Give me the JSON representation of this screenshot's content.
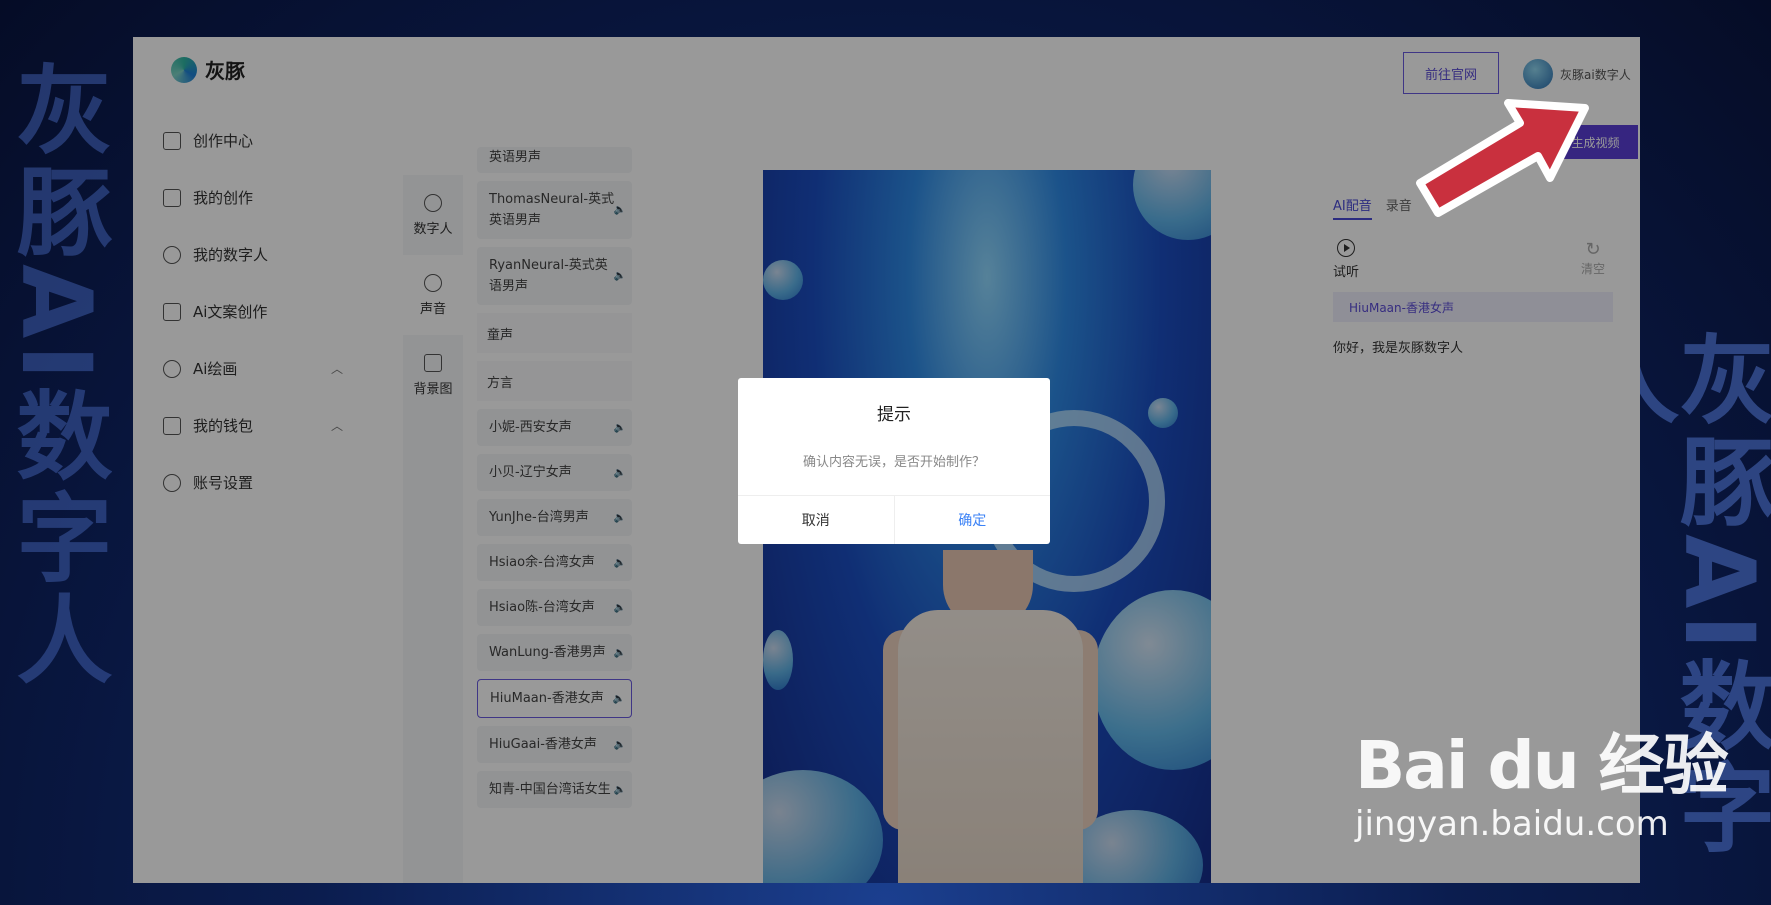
{
  "side_text_left": "灰豚AI数字人",
  "side_text_right": "灰豚AI数字人",
  "app": {
    "logo_text": "灰豚",
    "go_site": "前往官网",
    "user_name": "灰豚ai数字人",
    "generate_label": "生成视频"
  },
  "nav": {
    "items": [
      {
        "label": "创作中心",
        "icon": "chart-icon"
      },
      {
        "label": "我的创作",
        "icon": "folder-icon"
      },
      {
        "label": "我的数字人",
        "icon": "user-icon"
      },
      {
        "label": "Ai文案创作",
        "icon": "edit-icon"
      },
      {
        "label": "Ai绘画",
        "icon": "palette-icon",
        "chevron": "︿"
      },
      {
        "label": "我的钱包",
        "icon": "wallet-icon",
        "chevron": "︿"
      },
      {
        "label": "账号设置",
        "icon": "gear-icon"
      }
    ]
  },
  "tabs": [
    {
      "label": "数字人",
      "icon": "person-icon"
    },
    {
      "label": "声音",
      "icon": "mic-icon"
    },
    {
      "label": "背景图",
      "icon": "image-icon"
    }
  ],
  "voices": {
    "top_partial": "英语男声",
    "english": [
      "ThomasNeural-英式英语男声",
      "RyanNeural-英式英语男声"
    ],
    "group_child": "童声",
    "group_dialect": "方言",
    "dialect": [
      "小妮-西安女声",
      "小贝-辽宁女声",
      "YunJhe-台湾男声",
      "Hsiao余-台湾女声",
      "Hsiao陈-台湾女声",
      "WanLung-香港男声"
    ],
    "selected": "HiuMaan-香港女声",
    "after": [
      "HiuGaai-香港女声",
      "知青-中国台湾话女生"
    ]
  },
  "right_panel": {
    "tab_active": "AI配音",
    "tab_other": "录音",
    "listen": "试听",
    "clear": "清空",
    "voice_chip": "HiuMaan-香港女声",
    "script": "你好，我是灰豚数字人"
  },
  "dialog": {
    "title": "提示",
    "message": "确认内容无误，是否开始制作？",
    "cancel": "取消",
    "confirm": "确定"
  },
  "watermark": {
    "main": "Bai du 经验",
    "sub": "jingyan.baidu.com"
  }
}
